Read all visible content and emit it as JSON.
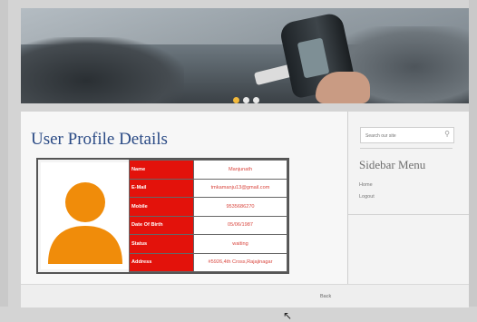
{
  "page": {
    "title": "User Profile Details",
    "footer_link": "Back"
  },
  "profile": {
    "rows": [
      {
        "label": "Name",
        "value": "Manjunath"
      },
      {
        "label": "E-Mail",
        "value": "tmkamanju13@gmail.com"
      },
      {
        "label": "Mobile",
        "value": "9535686270"
      },
      {
        "label": "Date Of Birth",
        "value": "05/06/1987"
      },
      {
        "label": "Status",
        "value": "waiting"
      },
      {
        "label": "Address",
        "value": "#5926,4th Cross,Rajajinagar"
      }
    ]
  },
  "sidebar": {
    "search_placeholder": "Search our site",
    "title": "Sidebar Menu",
    "menu": [
      {
        "label": "Home"
      },
      {
        "label": "Logout"
      }
    ]
  },
  "carousel": {
    "slide_count": 3,
    "active_index": 0
  },
  "colors": {
    "label_bg": "#e3120b",
    "value_text": "#d9463e",
    "title": "#2a4a85",
    "avatar": "#f08c0a",
    "active_dot": "#f2b93b"
  },
  "icons": {
    "search": "search-icon",
    "avatar": "user-avatar-icon"
  }
}
